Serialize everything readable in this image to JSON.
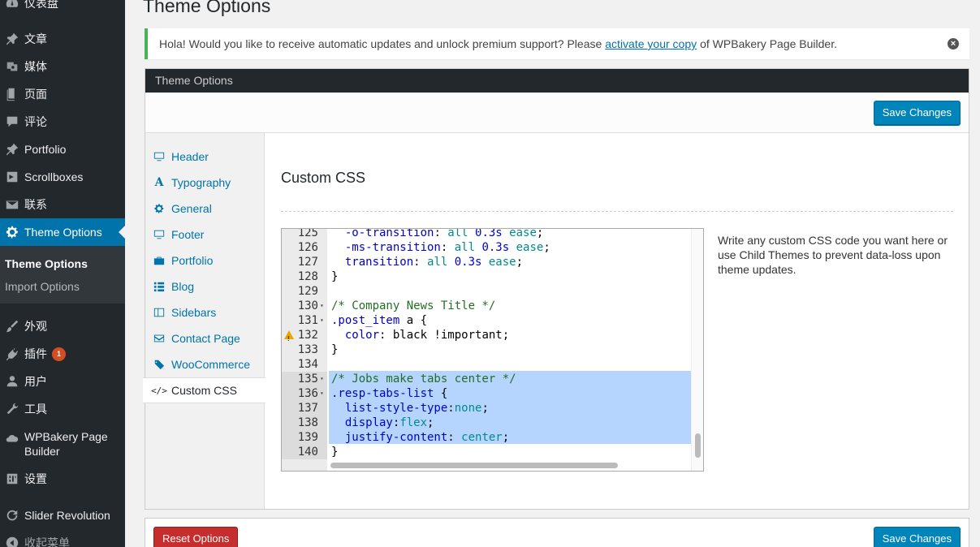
{
  "sidebar": {
    "items": [
      {
        "label": "仪表盘",
        "icon": "dashboard-icon"
      },
      {
        "label": "文章",
        "icon": "pin-icon"
      },
      {
        "label": "媒体",
        "icon": "media-icon"
      },
      {
        "label": "页面",
        "icon": "page-icon"
      },
      {
        "label": "评论",
        "icon": "comment-icon"
      },
      {
        "label": "Portfolio",
        "icon": "pin-icon"
      },
      {
        "label": "Scrollboxes",
        "icon": "scrollbox-icon"
      },
      {
        "label": "联系",
        "icon": "mail-icon"
      },
      {
        "label": "Theme Options",
        "icon": "gear-icon"
      },
      {
        "label": "外观",
        "icon": "brush-icon"
      },
      {
        "label": "插件",
        "icon": "plugin-icon",
        "badge": "1"
      },
      {
        "label": "用户",
        "icon": "user-icon"
      },
      {
        "label": "工具",
        "icon": "wrench-icon"
      },
      {
        "label": "WPBakery Page Builder",
        "icon": "cloud-icon"
      },
      {
        "label": "设置",
        "icon": "settings-icon"
      },
      {
        "label": "Slider Revolution",
        "icon": "refresh-icon"
      },
      {
        "label": "收起菜单",
        "icon": "collapse-icon"
      }
    ],
    "submenu": [
      "Theme Options",
      "Import Options"
    ]
  },
  "page": {
    "title": "Theme Options"
  },
  "notice": {
    "text_before": "Hola! Would you like to receive automatic updates and unlock premium support? Please",
    "link": "activate your copy",
    "text_after": "of WPBakery Page Builder.",
    "close": "×"
  },
  "panel": {
    "header": "Theme Options",
    "save_label": "Save Changes",
    "reset_label": "Reset Options",
    "nav": [
      {
        "label": "Header",
        "icon": "monitor-icon"
      },
      {
        "label": "Typography",
        "icon": "font-icon"
      },
      {
        "label": "General",
        "icon": "gear-icon"
      },
      {
        "label": "Footer",
        "icon": "monitor-icon"
      },
      {
        "label": "Portfolio",
        "icon": "briefcase-icon"
      },
      {
        "label": "Blog",
        "icon": "list-icon"
      },
      {
        "label": "Sidebars",
        "icon": "sidebar-icon"
      },
      {
        "label": "Contact Page",
        "icon": "envelope-icon"
      },
      {
        "label": "WooCommerce",
        "icon": "tag-icon"
      },
      {
        "label": "Custom CSS",
        "icon": "code-icon"
      }
    ],
    "section_title": "Custom CSS",
    "description": "Write any custom CSS code you want here or use Child Themes to prevent data-loss upon theme updates."
  },
  "editor": {
    "lines": [
      {
        "n": "125",
        "code": "  -o-transition: all 0.3s ease;"
      },
      {
        "n": "126",
        "code": "  -ms-transition: all 0.3s ease;"
      },
      {
        "n": "127",
        "code": "  transition: all 0.3s ease;"
      },
      {
        "n": "128",
        "code": "}"
      },
      {
        "n": "129",
        "code": ""
      },
      {
        "n": "130",
        "code": "/* Company News Title */",
        "fold": true
      },
      {
        "n": "131",
        "code": ".post_item a {",
        "fold": true
      },
      {
        "n": "132",
        "code": "  color: black !important;",
        "warn": true
      },
      {
        "n": "133",
        "code": "}"
      },
      {
        "n": "134",
        "code": ""
      },
      {
        "n": "135",
        "code": "/* Jobs make tabs center */",
        "fold": true,
        "selected": true
      },
      {
        "n": "136",
        "code": ".resp-tabs-list {",
        "fold": true,
        "selected": true
      },
      {
        "n": "137",
        "code": "  list-style-type:none;",
        "selected": true
      },
      {
        "n": "138",
        "code": "  display:flex;",
        "warn": true,
        "selected": true
      },
      {
        "n": "139",
        "code": "  justify-content: center;",
        "warn": true,
        "selected": true
      },
      {
        "n": "140",
        "code": "}",
        "selected": true
      }
    ]
  },
  "colors": {
    "sidebar_bg": "#23282d",
    "accent": "#0073aa",
    "primary_button": "#0085ba",
    "danger_button": "#c62d2d",
    "notice_border": "#46b450",
    "selection": "#b5d5ff"
  }
}
